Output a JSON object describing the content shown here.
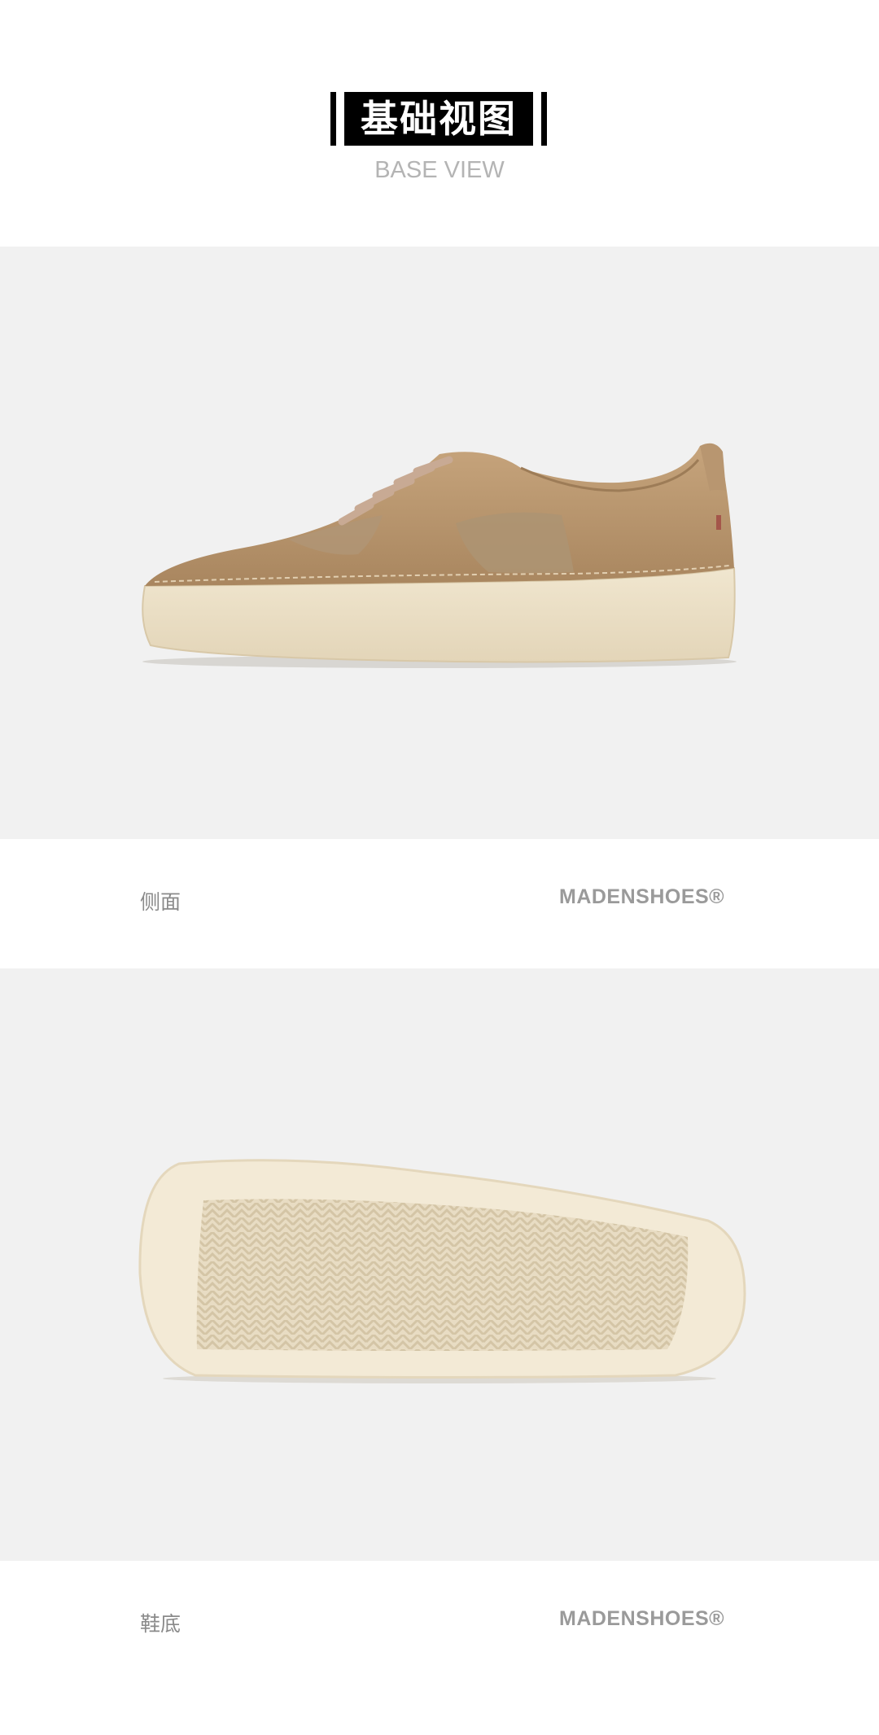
{
  "header": {
    "title": "基础视图",
    "subtitle": "BASE VIEW"
  },
  "side_view": {
    "image": "side-profile-sneaker-photo",
    "label": "侧面",
    "brand": "MADENSHOES®"
  },
  "sole_view": {
    "image": "outsole-herringbone-photo",
    "label": "鞋底",
    "brand": "MADENSHOES®"
  },
  "colors": {
    "panel_bg": "#f1f1f1",
    "upper_suede": "#b99770",
    "midsole": "#eadfc6",
    "caption_text": "#8a8a8a",
    "subtitle_text": "#b4b4b4"
  }
}
